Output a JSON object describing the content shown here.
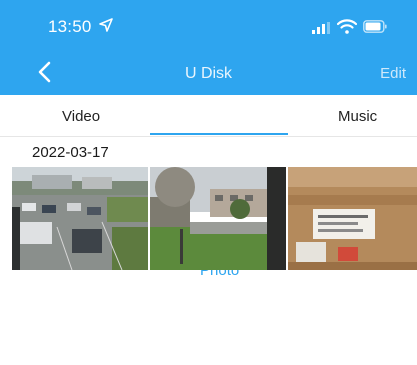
{
  "status_bar": {
    "time": "13:50"
  },
  "nav": {
    "title": "U Disk",
    "edit_label": "Edit"
  },
  "tabs": [
    {
      "label": "Video",
      "selected": false
    },
    {
      "label": "Photo",
      "selected": true
    },
    {
      "label": "Music",
      "selected": false
    }
  ],
  "gallery": {
    "date": "2022-03-17",
    "photos": [
      "parking-lot-photo",
      "courtyard-photo",
      "cardboard-box-photo"
    ]
  },
  "colors": {
    "accent": "#2ea5ef",
    "header": "#2ea5ef"
  }
}
